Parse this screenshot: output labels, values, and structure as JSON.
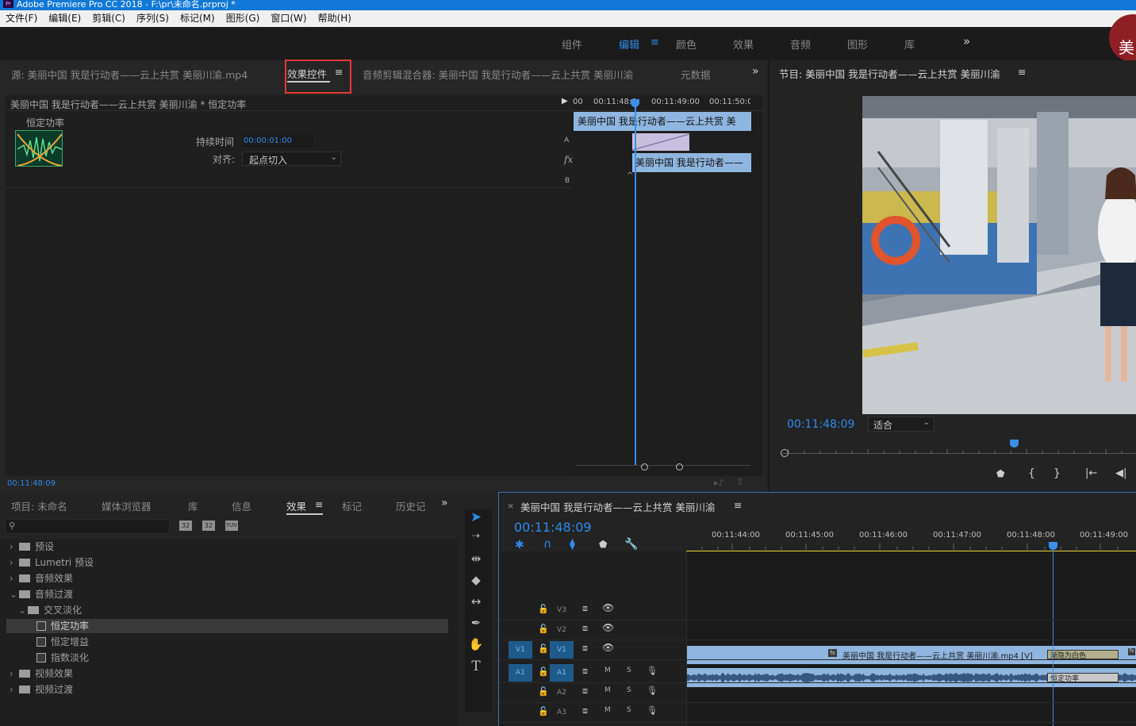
{
  "window": {
    "title": "Adobe Premiere Pro CC 2018 - F:\\pr\\未命名.prproj *"
  },
  "menu": [
    "文件(F)",
    "编辑(E)",
    "剪辑(C)",
    "序列(S)",
    "标记(M)",
    "图形(G)",
    "窗口(W)",
    "帮助(H)"
  ],
  "workspaces": {
    "items": [
      "组件",
      "编辑",
      "颜色",
      "效果",
      "音频",
      "图形",
      "库"
    ],
    "active": "编辑",
    "more": "»"
  },
  "source_panel": {
    "tabs": [
      "源: 美丽中国 我是行动者——云上共赏 美丽川渝.mp4",
      "效果控件",
      "音频剪辑混合器: 美丽中国 我是行动者——云上共赏 美丽川渝",
      "元数据"
    ],
    "active_tab": "效果控件",
    "menu_icon": "≡",
    "more": "»",
    "clip_path": "美丽中国 我是行动者——云上共赏 美丽川渝 * 恒定功率",
    "effect_name": "恒定功率",
    "duration_label": "持续时间",
    "duration_value": "00:00:01:00",
    "align_label": "对齐:",
    "align_value": "起点切入",
    "ruler": [
      "00",
      "00:11:48:0",
      "00:11:49:00",
      "00:11:50:0"
    ],
    "clip_a": "美丽中国 我是行动者——云上共赏 美",
    "clip_b": "美丽中国 我是行动者——",
    "label_a": "A",
    "label_b": "B",
    "fx": "fx",
    "timecode": "00:11:48:09"
  },
  "program_panel": {
    "title": "节目: 美丽中国 我是行动者——云上共赏 美丽川渝",
    "menu_icon": "≡",
    "timecode": "00:11:48:09",
    "fit": "适合",
    "controls": [
      "marker-icon",
      "in-icon",
      "out-icon",
      "go-in-icon",
      "step-back-icon"
    ]
  },
  "project_panel": {
    "tabs": [
      "项目: 未命名",
      "媒体浏览器",
      "库",
      "信息",
      "效果",
      "标记",
      "历史记"
    ],
    "active_tab": "效果",
    "menu_icon": "≡",
    "more": "»",
    "search_placeholder": "",
    "tree": [
      {
        "label": "预设",
        "indent": 0,
        "chevron": "›",
        "type": "folder-star"
      },
      {
        "label": "Lumetri 预设",
        "indent": 0,
        "chevron": "›",
        "type": "folder-star"
      },
      {
        "label": "音频效果",
        "indent": 0,
        "chevron": "›",
        "type": "folder"
      },
      {
        "label": "音频过渡",
        "indent": 0,
        "chevron": "⌄",
        "type": "folder"
      },
      {
        "label": "交叉淡化",
        "indent": 1,
        "chevron": "⌄",
        "type": "folder"
      },
      {
        "label": "恒定功率",
        "indent": 2,
        "chevron": "",
        "type": "effect",
        "selected": true
      },
      {
        "label": "恒定增益",
        "indent": 2,
        "chevron": "",
        "type": "effect"
      },
      {
        "label": "指数淡化",
        "indent": 2,
        "chevron": "",
        "type": "effect"
      },
      {
        "label": "视频效果",
        "indent": 0,
        "chevron": "›",
        "type": "folder"
      },
      {
        "label": "视频过渡",
        "indent": 0,
        "chevron": "›",
        "type": "folder"
      }
    ]
  },
  "timeline": {
    "title": "美丽中国 我是行动者——云上共赏 美丽川渝",
    "menu_icon": "≡",
    "close": "×",
    "timecode": "00:11:48:09",
    "ruler": [
      "00:11:44:00",
      "00:11:45:00",
      "00:11:46:00",
      "00:11:47:00",
      "00:11:48:00",
      "00:11:49:00"
    ],
    "tracks": [
      {
        "name": "V3",
        "kind": "video"
      },
      {
        "name": "V2",
        "kind": "video"
      },
      {
        "name": "V1",
        "kind": "video",
        "source": "V1"
      },
      {
        "name": "A1",
        "kind": "audio",
        "source": "A1",
        "m": "M",
        "s": "S"
      },
      {
        "name": "A2",
        "kind": "audio",
        "m": "M",
        "s": "S"
      },
      {
        "name": "A3",
        "kind": "audio",
        "m": "M",
        "s": "S"
      }
    ],
    "video_clip": "美丽中国 我是行动者——云上共赏 美丽川渝.mp4 [V]",
    "video_transition": "渐隐为白色",
    "audio_transition": "恒定功率"
  },
  "logo_text": "美",
  "colors": {
    "accent": "#2d8ceb",
    "clip_video": "#8fb6e0",
    "highlight": "#e53935",
    "workarea": "#e3d23c"
  }
}
